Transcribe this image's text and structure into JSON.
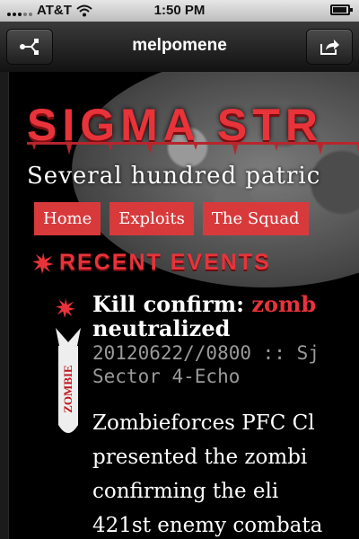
{
  "status_bar": {
    "carrier": "AT&T",
    "time": "1:50 PM"
  },
  "browser": {
    "title": "melpomene",
    "left_icon": "share-network-icon",
    "right_icon": "export-icon"
  },
  "site": {
    "title": "SIGMA STR",
    "tagline": "Several hundred patric",
    "nav": [
      "Home",
      "Exploits",
      "The Squad"
    ]
  },
  "section": {
    "title": "RECENT EVENTS"
  },
  "post": {
    "title_prefix": "Kill confirm: ",
    "title_accent": "zomb",
    "title_rest": "neutralized",
    "meta_line1": "20120622//0800 :: Sj",
    "meta_line2": "Sector 4-Echo",
    "badge": "ZOMBIE",
    "body": [
      "Zombieforces PFC Cl",
      "presented the zombi",
      "confirming the eli",
      "421st enemy combata"
    ]
  },
  "colors": {
    "accent": "#e8333a",
    "nav_bg": "#d83a3c",
    "page_bg": "#000000"
  }
}
